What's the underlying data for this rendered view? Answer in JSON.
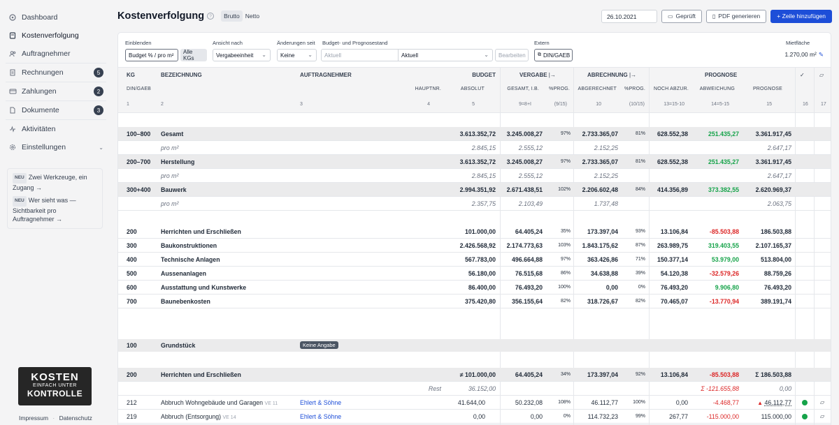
{
  "sidebar": {
    "items": [
      {
        "label": "Dashboard",
        "icon": "dashboard-icon",
        "badge": ""
      },
      {
        "label": "Kostenverfolgung",
        "icon": "ledger-icon",
        "badge": ""
      },
      {
        "label": "Auftragnehmer",
        "icon": "users-icon",
        "badge": ""
      },
      {
        "label": "Rechnungen",
        "icon": "invoice-icon",
        "badge": "5"
      },
      {
        "label": "Zahlungen",
        "icon": "payment-icon",
        "badge": "2"
      },
      {
        "label": "Dokumente",
        "icon": "documents-icon",
        "badge": "3"
      },
      {
        "label": "Aktivitäten",
        "icon": "activity-icon",
        "badge": ""
      },
      {
        "label": "Einstellungen",
        "icon": "gear-icon",
        "badge": ""
      }
    ],
    "news": [
      {
        "tag": "NEU",
        "text": "Zwei Werkzeuge, ein Zugang →"
      },
      {
        "tag": "NEU",
        "text": "Wer sieht was — Sichtbarkeit pro Auftragnehmer →"
      }
    ],
    "logo": {
      "line1": "KOSTEN",
      "line2": "EINFACH UNTER",
      "line3": "KONTROLLE"
    },
    "footer": {
      "impressum": "Impressum",
      "sep": "·",
      "datenschutz": "Datenschutz"
    }
  },
  "header": {
    "title": "Kostenverfolgung",
    "toggle": {
      "brutto": "Brutto",
      "netto": "Netto"
    },
    "date": "26.10.2021",
    "btn_checked": "Geprüft",
    "btn_pdf": "PDF generieren",
    "btn_add": "+ Zeile hinzufügen"
  },
  "filters": {
    "einblenden_label": "Einblenden",
    "einblenden_value": "Budget % / pro m²",
    "einblenden_chip": "Alle KGs",
    "ansicht_label": "Ansicht nach",
    "ansicht_value": "Vergabeeinheit",
    "aenderungen_label": "Änderungen seit",
    "aenderungen_value": "Keine",
    "budget_label": "Budget- und Prognosestand",
    "budget_placeholder": "Aktuell",
    "budget_value": "Aktuell",
    "budget_edit": "Bearbeiten",
    "extern_label": "Extern",
    "extern_value": "DIN/GAEB",
    "miet_label": "Mietfläche",
    "miet_value": "1.270,00 m²"
  },
  "columns": {
    "kg": "KG",
    "bez": "BEZEICHNUNG",
    "an": "AUFTRAGNEHMER",
    "budget": "BUDGET",
    "vergabe": "VERGABE",
    "abrechnung": "ABRECHNUNG",
    "prognose": "PROGNOSE",
    "dingaeb": "DIN/GAEB",
    "hauptnr": "HAUPTNR.",
    "absolut": "ABSOLUT",
    "gesamt_ib": "GESAMT, I.B.",
    "pct_prog": "%PROG.",
    "abgerechnet": "ABGERECHNET",
    "pct_prog2": "%PROG.",
    "noch_abzur": "NOCH ABZUR.",
    "abweichung": "ABWEICHUNG",
    "prognose2": "PROGNOSE",
    "n1": "1",
    "n2": "2",
    "n3": "3",
    "n4": "4",
    "n5": "5",
    "n9": "9=8+I",
    "n915": "(9/15)",
    "n10": "10",
    "n1015": "(10/15)",
    "n13": "13=15-10",
    "n14": "14=5-15",
    "n15": "15",
    "n16": "16",
    "n17": "17"
  },
  "rows": {
    "gesamt": {
      "kg": "100–800",
      "bez": "Gesamt",
      "budget": "3.613.352,72",
      "vergabe": "3.245.008,27",
      "vp": "97%",
      "abgerechnet": "2.733.365,07",
      "ap": "81%",
      "noch": "628.552,38",
      "abw": "251.435,27",
      "prog": "3.361.917,45"
    },
    "gesamt_m2": {
      "label": "pro m²",
      "budget": "2.845,15",
      "vergabe": "2.555,12",
      "abgerechnet": "2.152,25",
      "prog": "2.647,17"
    },
    "herstellung": {
      "kg": "200–700",
      "bez": "Herstellung",
      "budget": "3.613.352,72",
      "vergabe": "3.245.008,27",
      "vp": "97%",
      "abgerechnet": "2.733.365,07",
      "ap": "81%",
      "noch": "628.552,38",
      "abw": "251.435,27",
      "prog": "3.361.917,45"
    },
    "herstellung_m2": {
      "label": "pro m²",
      "budget": "2.845,15",
      "vergabe": "2.555,12",
      "abgerechnet": "2.152,25",
      "prog": "2.647,17"
    },
    "bauwerk": {
      "kg": "300+400",
      "bez": "Bauwerk",
      "budget": "2.994.351,92",
      "vergabe": "2.671.438,51",
      "vp": "102%",
      "abgerechnet": "2.206.602,48",
      "ap": "84%",
      "noch": "414.356,89",
      "abw": "373.382,55",
      "prog": "2.620.969,37"
    },
    "bauwerk_m2": {
      "label": "pro m²",
      "budget": "2.357,75",
      "vergabe": "2.103,49",
      "abgerechnet": "1.737,48",
      "prog": "2.063,75"
    },
    "groups": [
      {
        "kg": "200",
        "bez": "Herrichten und Erschließen",
        "budget": "101.000,00",
        "vergabe": "64.405,24",
        "vp": "35%",
        "abgerechnet": "173.397,04",
        "ap": "93%",
        "noch": "13.106,84",
        "abw": "-85.503,88",
        "prog": "186.503,88",
        "abw_color": "red"
      },
      {
        "kg": "300",
        "bez": "Baukonstruktionen",
        "budget": "2.426.568,92",
        "vergabe": "2.174.773,63",
        "vp": "103%",
        "abgerechnet": "1.843.175,62",
        "ap": "87%",
        "noch": "263.989,75",
        "abw": "319.403,55",
        "prog": "2.107.165,37",
        "abw_color": "green"
      },
      {
        "kg": "400",
        "bez": "Technische Anlagen",
        "budget": "567.783,00",
        "vergabe": "496.664,88",
        "vp": "97%",
        "abgerechnet": "363.426,86",
        "ap": "71%",
        "noch": "150.377,14",
        "abw": "53.979,00",
        "prog": "513.804,00",
        "abw_color": "green"
      },
      {
        "kg": "500",
        "bez": "Aussenanlagen",
        "budget": "56.180,00",
        "vergabe": "76.515,68",
        "vp": "86%",
        "abgerechnet": "34.638,88",
        "ap": "39%",
        "noch": "54.120,38",
        "abw": "-32.579,26",
        "prog": "88.759,26",
        "abw_color": "red"
      },
      {
        "kg": "600",
        "bez": "Ausstattung und Kunstwerke",
        "budget": "86.400,00",
        "vergabe": "76.493,20",
        "vp": "100%",
        "abgerechnet": "0,00",
        "ap": "0%",
        "noch": "76.493,20",
        "abw": "9.906,80",
        "prog": "76.493,20",
        "abw_color": "green"
      },
      {
        "kg": "700",
        "bez": "Baunebenkosten",
        "budget": "375.420,80",
        "vergabe": "356.155,64",
        "vp": "82%",
        "abgerechnet": "318.726,67",
        "ap": "82%",
        "noch": "70.465,07",
        "abw": "-13.770,94",
        "prog": "389.191,74",
        "abw_color": "red"
      }
    ],
    "grundstueck": {
      "kg": "100",
      "bez": "Grundstück",
      "tag": "Keine Angabe"
    },
    "herrichten": {
      "kg": "200",
      "bez": "Herrichten und Erschließen",
      "budget": "≠ 101.000,00",
      "vergabe": "64.405,24",
      "vp": "34%",
      "abgerechnet": "173.397,04",
      "ap": "92%",
      "noch": "13.106,84",
      "abw": "-85.503,88",
      "prog": "Σ 186.503,88"
    },
    "rest": {
      "label": "Rest",
      "budget": "36.152,00",
      "abw": "Σ -121.655,88",
      "prog": "0,00"
    },
    "items": [
      {
        "kg": "212",
        "bez": "Abbruch Wohngebäude und Garagen",
        "ve": "VE 11",
        "an": "Ehlert & Söhne",
        "budget": "41.644,00",
        "vergabe": "50.232,08",
        "vp": "108%",
        "abgerechnet": "46.112,77",
        "ap": "100%",
        "noch": "0,00",
        "abw": "-4.468,77",
        "prog": "46.112,77"
      },
      {
        "kg": "219",
        "bez": "Abbruch (Entsorgung)",
        "ve": "VE 14",
        "an": "Ehlert & Söhne",
        "budget": "0,00",
        "vergabe": "0,00",
        "vp": "0%",
        "abgerechnet": "114.732,23",
        "ap": "99%",
        "noch": "267,77",
        "abw": "-115.000,00",
        "prog": "115.000,00"
      }
    ]
  }
}
